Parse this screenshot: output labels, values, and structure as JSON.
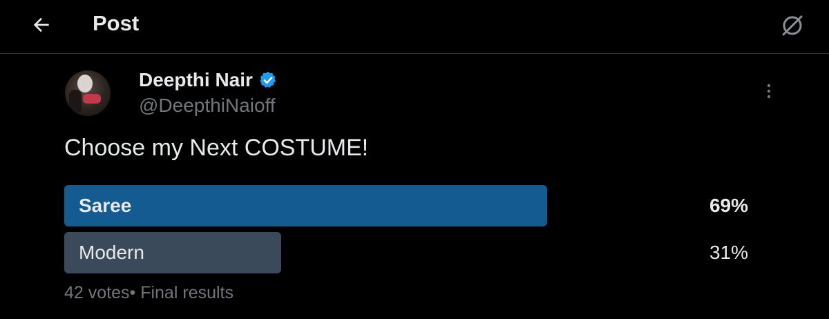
{
  "header": {
    "title": "Post",
    "back_icon": "arrow-left-icon",
    "grok_icon": "grok-icon"
  },
  "post": {
    "author": {
      "display_name": "Deepthi Nair",
      "handle": "@DeepthiNaioff",
      "verified": true
    },
    "text": "Choose my Next COSTUME!",
    "poll": {
      "options": [
        {
          "label": "Saree",
          "percent_text": "69%",
          "fraction": 0.69,
          "winner": true
        },
        {
          "label": "Modern",
          "percent_text": "31%",
          "fraction": 0.31,
          "winner": false
        }
      ],
      "meta": "42 votes• Final results"
    }
  },
  "colors": {
    "background": "#000000",
    "winner_bar": "#135b91",
    "loser_bar": "#3b4a5a",
    "verified": "#1d9bf0",
    "secondary_text": "#71767b"
  }
}
